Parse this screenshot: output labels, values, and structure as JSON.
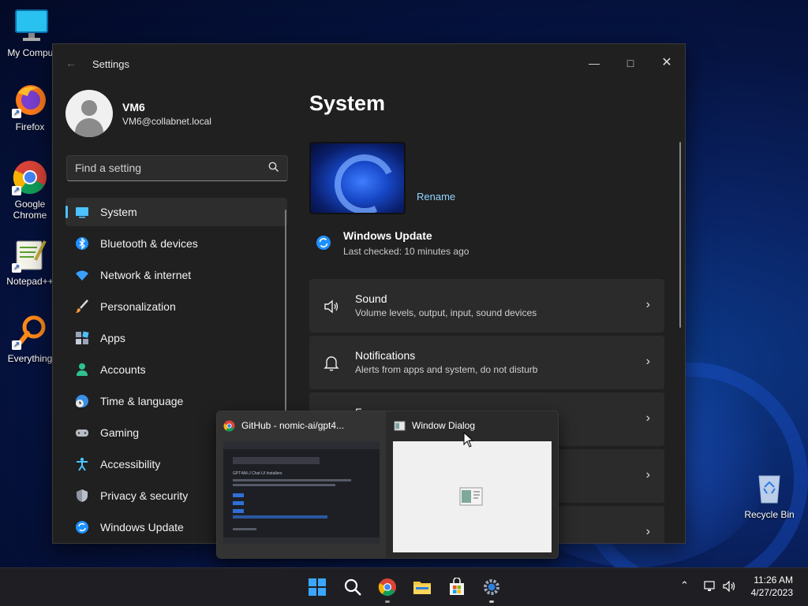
{
  "desktop": {
    "icons": [
      {
        "label": "My Comput",
        "icon": "monitor-icon"
      },
      {
        "label": "Firefox",
        "icon": "firefox-icon"
      },
      {
        "label": "Google\nChrome",
        "icon": "chrome-icon"
      },
      {
        "label": "Notepad++",
        "icon": "notepadpp-icon"
      },
      {
        "label": "Everything",
        "icon": "everything-icon"
      },
      {
        "label": "Recycle Bin",
        "icon": "recycle-bin-icon"
      }
    ]
  },
  "settings": {
    "title": "Settings",
    "profile": {
      "name": "VM6",
      "email": "VM6@collabnet.local"
    },
    "search": {
      "placeholder": "Find a setting"
    },
    "nav": [
      {
        "label": "System",
        "icon": "system-icon",
        "selected": true
      },
      {
        "label": "Bluetooth & devices",
        "icon": "bluetooth-icon"
      },
      {
        "label": "Network & internet",
        "icon": "wifi-icon"
      },
      {
        "label": "Personalization",
        "icon": "brush-icon"
      },
      {
        "label": "Apps",
        "icon": "apps-icon"
      },
      {
        "label": "Accounts",
        "icon": "accounts-icon"
      },
      {
        "label": "Time & language",
        "icon": "clock-globe-icon"
      },
      {
        "label": "Gaming",
        "icon": "gamepad-icon"
      },
      {
        "label": "Accessibility",
        "icon": "accessibility-icon"
      },
      {
        "label": "Privacy & security",
        "icon": "shield-icon"
      },
      {
        "label": "Windows Update",
        "icon": "update-icon"
      }
    ],
    "main": {
      "page_title": "System",
      "rename_label": "Rename",
      "windows_update": {
        "title": "Windows Update",
        "subtitle": "Last checked: 10 minutes ago"
      },
      "cards": [
        {
          "title": "Sound",
          "subtitle": "Volume levels, output, input, sound devices",
          "icon": "speaker-icon"
        },
        {
          "title": "Notifications",
          "subtitle": "Alerts from apps and system, do not disturb",
          "icon": "bell-icon"
        },
        {
          "title": "F",
          "subtitle": "",
          "icon": "focus-icon"
        },
        {
          "title": "",
          "subtitle": "",
          "icon": ""
        },
        {
          "title": "",
          "subtitle": "",
          "icon": ""
        }
      ]
    }
  },
  "preview": {
    "items": [
      {
        "title": "GitHub - nomic-ai/gpt4...",
        "icon": "chrome-icon"
      },
      {
        "title": "Window Dialog",
        "icon": "window-dialog-icon"
      }
    ],
    "thumb_text": {
      "heading": "GPT4All-J Chat UI Installers",
      "line1": "Installers",
      "line2": "Then move on to the installers for GPT4All"
    }
  },
  "taskbar": {
    "time": "11:26 AM",
    "date": "4/27/2023"
  },
  "colors": {
    "accent": "#4cc2ff",
    "link": "#8fd3ff",
    "window_bg": "#202020",
    "card_bg": "#2b2b2b"
  }
}
